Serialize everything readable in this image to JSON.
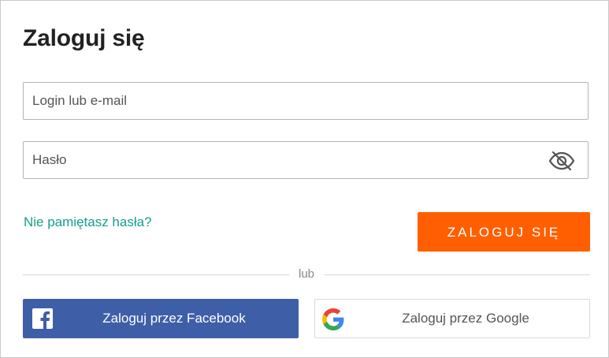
{
  "title": "Zaloguj się",
  "login_field": {
    "placeholder": "Login lub e-mail",
    "value": ""
  },
  "password_field": {
    "placeholder": "Hasło",
    "value": "",
    "toggle_icon": "eye-off-icon"
  },
  "forgot_link": "Nie pamiętasz hasła?",
  "login_button": "ZALOGUJ SIĘ",
  "divider_text": "lub",
  "social": {
    "facebook_label": "Zaloguj przez Facebook",
    "facebook_icon": "facebook-icon",
    "google_label": "Zaloguj przez Google",
    "google_icon": "google-icon"
  },
  "colors": {
    "accent": "#ff5f00",
    "link": "#15a08a",
    "facebook": "#3f5ea8"
  }
}
